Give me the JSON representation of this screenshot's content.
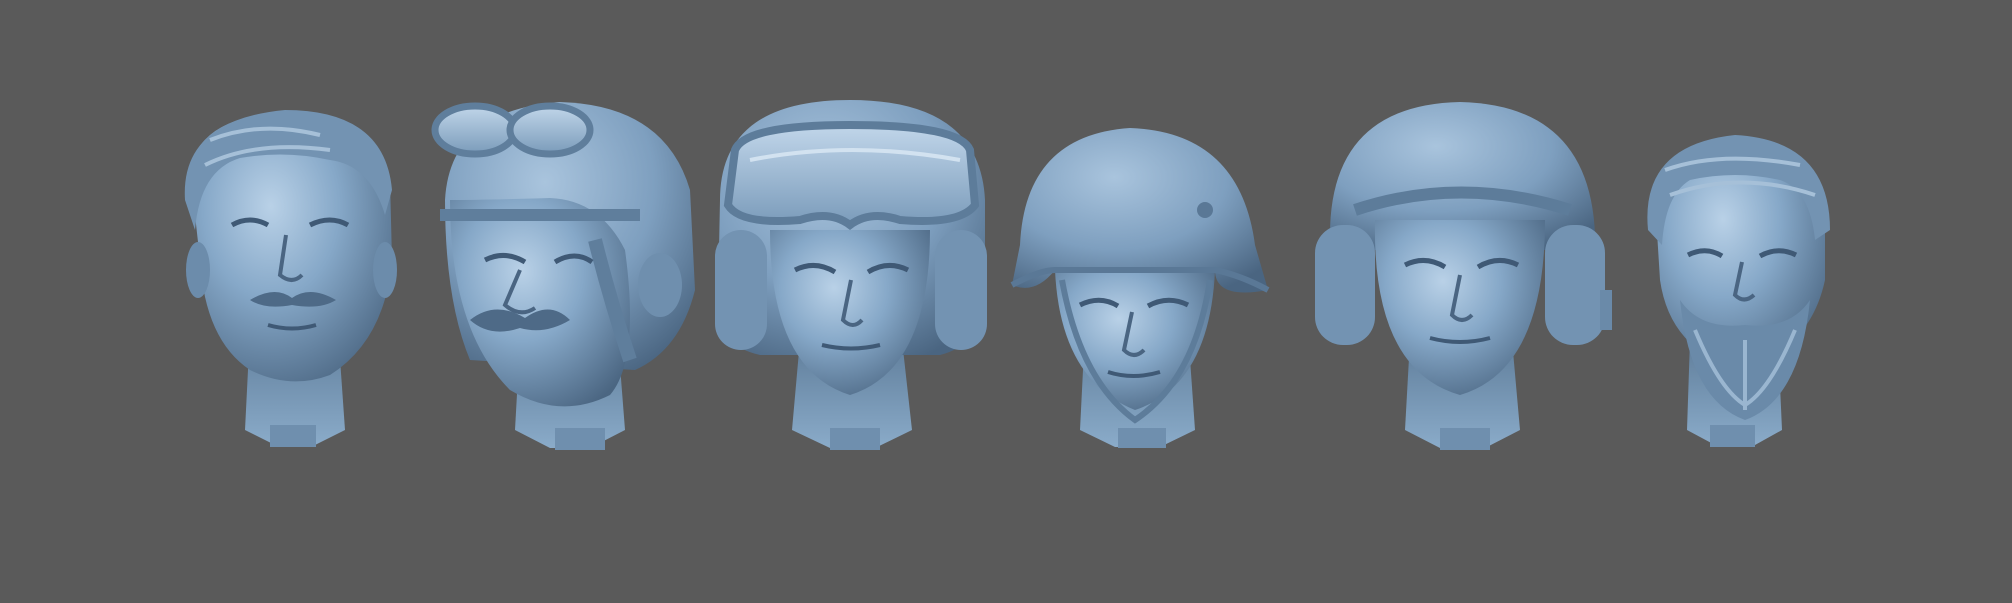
{
  "scene": {
    "background": "#5a5a5a",
    "model_color": "#7d9fbf",
    "highlight_color": "#b4cde4",
    "shadow_color": "#3d5670",
    "models": [
      {
        "id": "head-mustache-hair",
        "headgear": "none",
        "facial_hair": "mustache"
      },
      {
        "id": "head-aviator-goggles",
        "headgear": "leather-flying-helmet-with-goggles",
        "facial_hair": "mustache"
      },
      {
        "id": "head-tanker-goggles",
        "headgear": "padded-helmet-with-large-goggles",
        "facial_hair": "none"
      },
      {
        "id": "head-stahlhelm",
        "headgear": "steel-helmet",
        "facial_hair": "none"
      },
      {
        "id": "head-tanker-headset",
        "headgear": "round-helmet-with-headset",
        "facial_hair": "none"
      },
      {
        "id": "head-beard-hair",
        "headgear": "none",
        "facial_hair": "full-beard"
      }
    ]
  }
}
